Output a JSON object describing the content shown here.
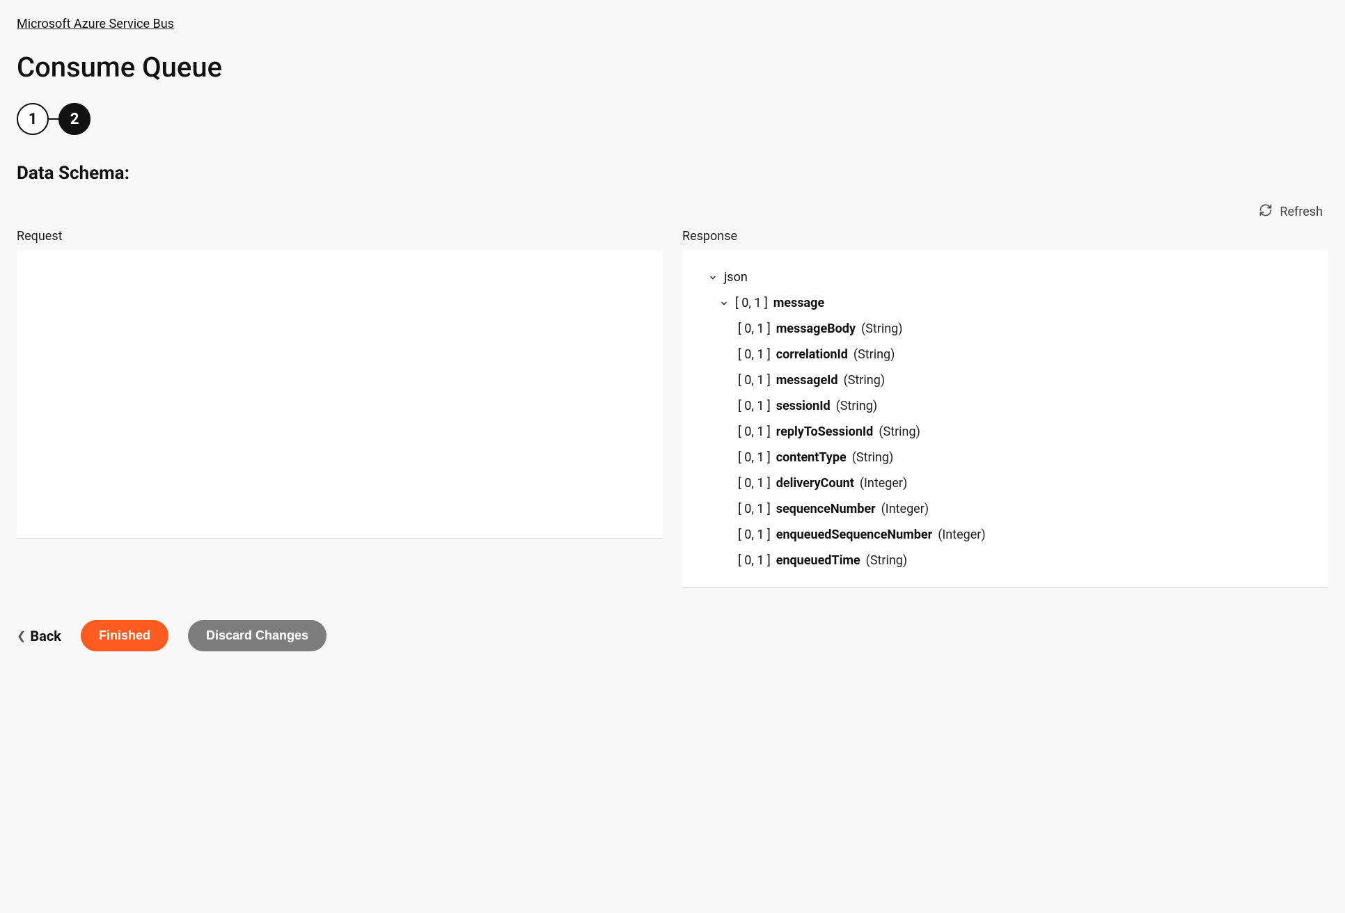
{
  "breadcrumb": "Microsoft Azure Service Bus",
  "page_title": "Consume Queue",
  "stepper": {
    "step1": "1",
    "step2": "2"
  },
  "section_heading": "Data Schema:",
  "refresh_label": "Refresh",
  "panels": {
    "request_label": "Request",
    "response_label": "Response"
  },
  "response_tree": {
    "root": "json",
    "message_card": "[ 0, 1 ]",
    "message_name": "message",
    "fields": [
      {
        "card": "[ 0, 1 ]",
        "name": "messageBody",
        "type": "(String)"
      },
      {
        "card": "[ 0, 1 ]",
        "name": "correlationId",
        "type": "(String)"
      },
      {
        "card": "[ 0, 1 ]",
        "name": "messageId",
        "type": "(String)"
      },
      {
        "card": "[ 0, 1 ]",
        "name": "sessionId",
        "type": "(String)"
      },
      {
        "card": "[ 0, 1 ]",
        "name": "replyToSessionId",
        "type": "(String)"
      },
      {
        "card": "[ 0, 1 ]",
        "name": "contentType",
        "type": "(String)"
      },
      {
        "card": "[ 0, 1 ]",
        "name": "deliveryCount",
        "type": "(Integer)"
      },
      {
        "card": "[ 0, 1 ]",
        "name": "sequenceNumber",
        "type": "(Integer)"
      },
      {
        "card": "[ 0, 1 ]",
        "name": "enqueuedSequenceNumber",
        "type": "(Integer)"
      },
      {
        "card": "[ 0, 1 ]",
        "name": "enqueuedTime",
        "type": "(String)"
      }
    ]
  },
  "footer": {
    "back": "Back",
    "finished": "Finished",
    "discard": "Discard Changes"
  }
}
